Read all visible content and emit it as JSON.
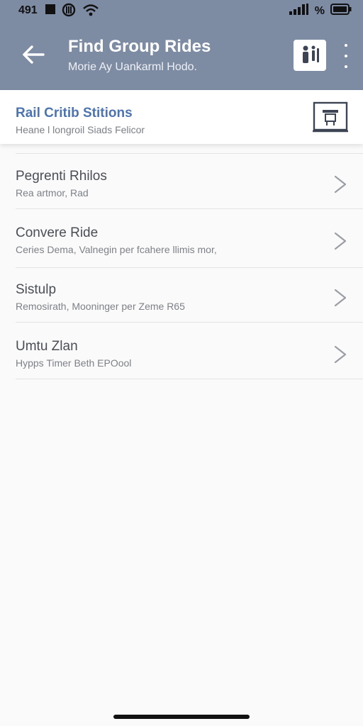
{
  "status_bar": {
    "time": "491",
    "battery_percent_label": "%"
  },
  "header": {
    "title": "Find Group Rides",
    "subtitle": "Morie Ay Uankarml Hodo."
  },
  "station_card": {
    "title": "Rail Critib Stitions",
    "subtitle": "Heane l longroil Siads Felicor"
  },
  "rides": [
    {
      "title": "Pegrenti Rhilos",
      "subtitle": "Rea artmor, Rad"
    },
    {
      "title": "Convere Ride",
      "subtitle": "Ceries Dema, Valnegin per fcahere llimis mor,"
    },
    {
      "title": "Sistulp",
      "subtitle": "Remosirath, Mooninger per Zeme R65"
    },
    {
      "title": "Umtu Zlan",
      "subtitle": "Hypps Timer Beth EPOool"
    }
  ],
  "colors": {
    "header_bg": "#7d8ba3",
    "accent": "#4c74b0",
    "background": "#fafafa"
  },
  "icons": [
    "back-arrow-icon",
    "profile-pair-icon",
    "more-vertical-icon",
    "station-sign-icon",
    "chevron-right-icon",
    "wifi-icon",
    "signal-icon",
    "battery-icon"
  ]
}
